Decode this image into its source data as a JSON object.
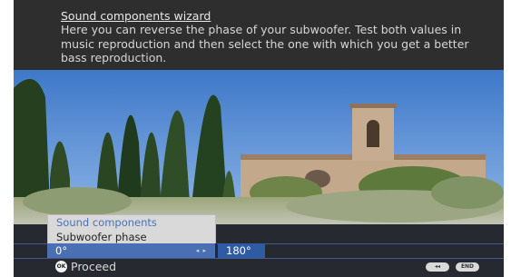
{
  "wizard": {
    "title": "Sound components wizard",
    "description": "Here you can reverse the phase of your subwoofer. Test both values in music reproduction and then select the one with which you get a better bass reproduction."
  },
  "menu": {
    "header": "Sound components",
    "item": "Subwoofer phase"
  },
  "options": {
    "selected_value": "0°",
    "arrows_glyph": "◂ ▸",
    "other_value": "180°"
  },
  "footer": {
    "ok_icon_glyph": "OK",
    "proceed_label": "Proceed",
    "back_glyph": "◂◂",
    "end_label": "END"
  },
  "colors": {
    "panel_bg": "#2e2e2e",
    "accent_blue": "#4a6fb2",
    "menu_bg": "#d9d9d9",
    "menu_header_text": "#4a72b8"
  },
  "icons": {
    "ok": "ok-button-icon",
    "back": "rewind-button-icon",
    "end": "end-button-icon"
  }
}
